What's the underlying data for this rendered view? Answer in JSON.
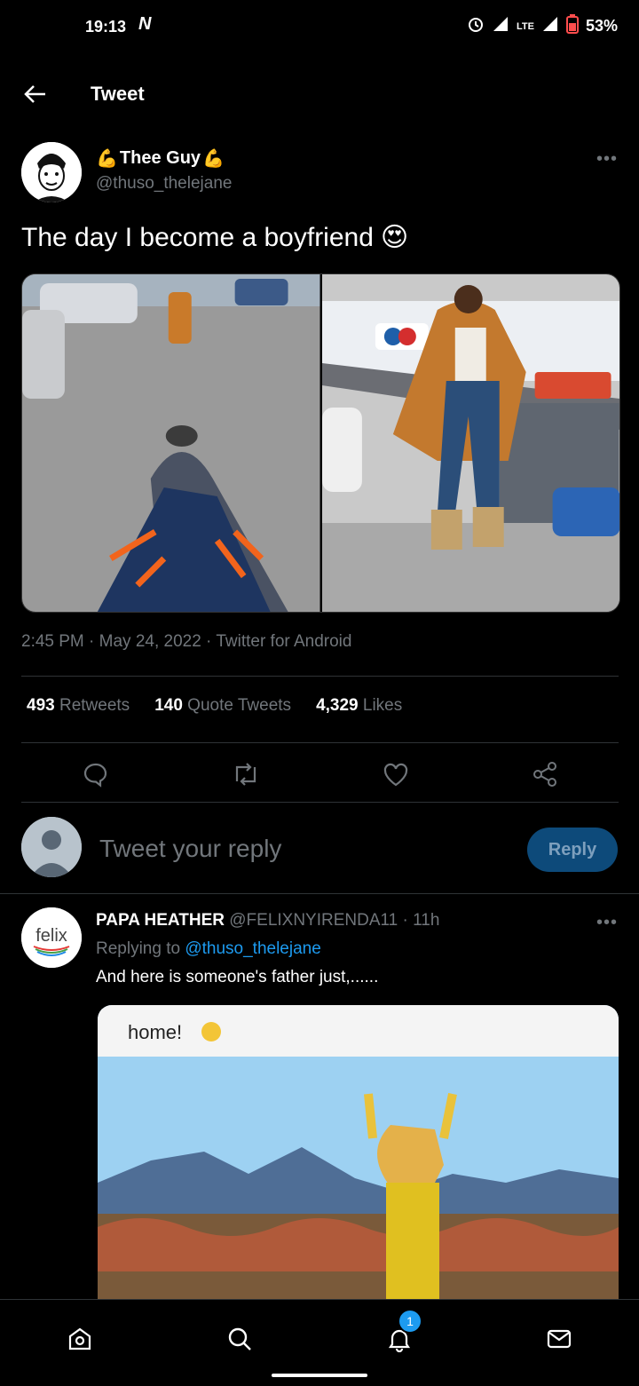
{
  "status": {
    "time": "19:13",
    "carrier_logo": "N",
    "network": "LTE",
    "battery": "53%"
  },
  "header": {
    "title": "Tweet"
  },
  "tweet": {
    "author_name": "Thee Guy",
    "author_handle": "@thuso_thelejane",
    "more": "•••",
    "text": "The day I become a boyfriend",
    "emoji": "😍",
    "meta": "2:45 PM · May 24, 2022 · Twitter for Android",
    "stats": {
      "retweets_count": "493",
      "retweets_label": "Retweets",
      "quotes_count": "140",
      "quotes_label": "Quote Tweets",
      "likes_count": "4,329",
      "likes_label": "Likes"
    }
  },
  "composer": {
    "placeholder": "Tweet your reply",
    "button": "Reply"
  },
  "reply": {
    "name": "PAPA HEATHER",
    "handle_time": "@FELIXNYIRENDA11 · 11h",
    "replying_prefix": "Replying to",
    "replying_to": "@thuso_thelejane",
    "text": "And here is someone's father just,......",
    "avatar_label": "felix",
    "media_caption": "home!"
  },
  "nav": {
    "notification_count": "1"
  },
  "colors": {
    "accent": "#1d9bf0",
    "background": "#000000",
    "muted": "#71767b"
  }
}
